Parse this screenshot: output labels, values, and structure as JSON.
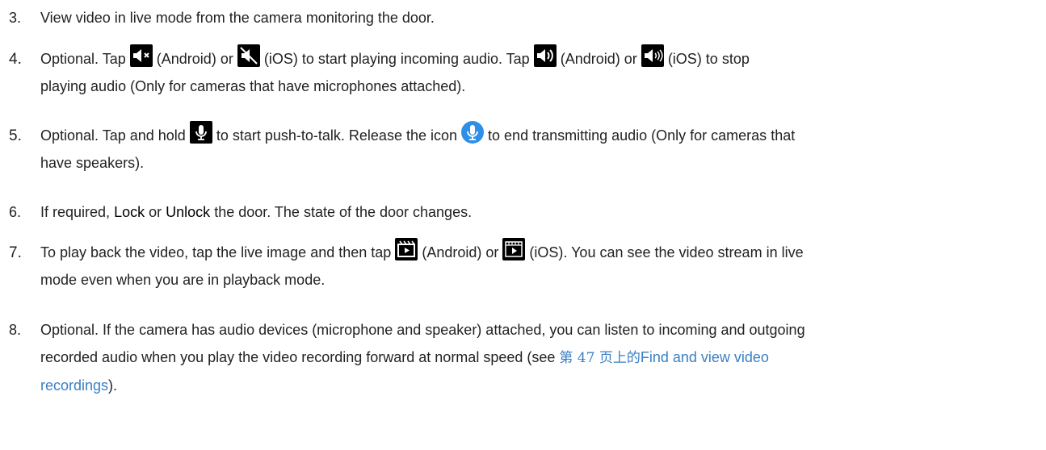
{
  "steps": [
    {
      "num": "3.",
      "text": "View video in live mode from the camera monitoring the door."
    },
    {
      "num": "4.",
      "t1": "Optional. Tap",
      "t2": "(Android) or",
      "t3": "(iOS) to start playing incoming audio. Tap",
      "t4": "(Android) or",
      "t5": "(iOS) to stop",
      "t6": "playing audio (Only for cameras that have microphones attached)."
    },
    {
      "num": "5.",
      "t1": "Optional. Tap and hold",
      "t2": "to start push-to-talk. Release the icon",
      "t3": "to end transmitting audio (Only for cameras that",
      "t4": "have speakers)."
    },
    {
      "num": "6.",
      "t1": "If required,",
      "lock": "Lock",
      "t2": "or",
      "unlock": "Unlock",
      "t3": "the door. The state of the door changes."
    },
    {
      "num": "7.",
      "t1": "To play back the video, tap the live image and then tap",
      "t2": "(Android) or",
      "t3": "(iOS). You can see the video stream in live",
      "t4": "mode even when you are in playback mode."
    },
    {
      "num": "8.",
      "t1": "Optional. If the camera has audio devices (microphone and speaker) attached, you can listen to incoming and outgoing",
      "t2": "recorded audio when you play the video recording forward at normal speed (see",
      "link_cn": "第 47 页上的",
      "link_en": "Find and view video",
      "link_cont": "recordings",
      "t3": ")."
    }
  ],
  "icons": {
    "mute_android": "speaker-muted-android-icon",
    "mute_ios": "speaker-muted-ios-icon",
    "sound_android": "speaker-on-android-icon",
    "sound_ios": "speaker-on-ios-icon",
    "mic": "microphone-icon",
    "mic_active": "microphone-active-icon",
    "playback_android": "playback-android-icon",
    "playback_ios": "playback-ios-icon",
    "link_color": "#3a7fc4",
    "mic_active_color": "#2f8fe6"
  }
}
